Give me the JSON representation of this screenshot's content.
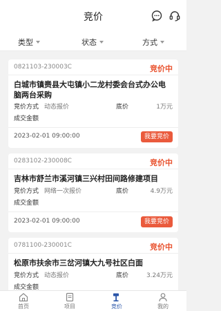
{
  "header": {
    "title": "竞价"
  },
  "filters": [
    {
      "label": "类型"
    },
    {
      "label": "状态"
    },
    {
      "label": "方式"
    }
  ],
  "cards": [
    {
      "code": "0821103-230003C",
      "status": "竞价中",
      "title": "白城市镇赉县大屯镇小二龙村委会台式办公电脑两台采购",
      "method_label": "竞价方式",
      "method_value": "动态报价",
      "floor_label": "底价",
      "floor_value": "1万元",
      "deal_label": "成交金额",
      "date": "2023-02-01 09:00:00",
      "button": "我要竞价"
    },
    {
      "code": "0283102-230008C",
      "status": "竞价中",
      "title": "吉林市舒兰市溪河镇三兴村田间路修建项目",
      "method_label": "竞价方式",
      "method_value": "网络一次报价",
      "floor_label": "底价",
      "floor_value": "4.9万元",
      "deal_label": "成交金额",
      "date": "2023-02-01 09:00:00",
      "button": "我要竞价"
    },
    {
      "code": "0781100-230001C",
      "status": "竞价中",
      "title": "松原市扶余市三岔河镇大九号社区白面",
      "method_label": "竞价方式",
      "method_value": "动态报价",
      "floor_label": "底价",
      "floor_value": "3.24万元",
      "deal_label": "成交金额"
    }
  ],
  "tabs": [
    {
      "label": "首页"
    },
    {
      "label": "项目"
    },
    {
      "label": "竞价"
    },
    {
      "label": "我的"
    }
  ],
  "colors": {
    "accent": "#ea5a3c",
    "status": "#e8502c",
    "tab_active": "#2a55a8"
  }
}
